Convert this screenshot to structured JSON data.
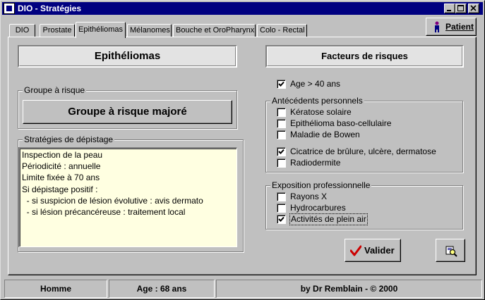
{
  "window": {
    "title": "DIO - Stratégies",
    "controls": [
      "minimize-icon",
      "maximize-icon",
      "close-icon"
    ]
  },
  "tabs": [
    {
      "label": "DIO",
      "active": false
    },
    {
      "label": "Prostate",
      "active": false
    },
    {
      "label": "Epithéliomas",
      "active": true
    },
    {
      "label": "Mélanomes",
      "active": false
    },
    {
      "label": "Bouche et OroPharynx",
      "active": false
    },
    {
      "label": "Colo - Rectal",
      "active": false
    }
  ],
  "patient_button": {
    "label": "Patient",
    "icon": "person-icon"
  },
  "left": {
    "section_title": "Epithéliomas",
    "risk_group": {
      "legend": "Groupe à risque",
      "value": "Groupe à risque majoré"
    },
    "strategies": {
      "legend": "Stratégies de dépistage",
      "lines": [
        "Inspection de la peau",
        "Périodicité : annuelle",
        "Limite fixée à 70 ans",
        "Si dépistage positif :",
        "  - si suspicion de lésion évolutive : avis dermato",
        "  - si lésion précancéreuse : traitement local"
      ]
    }
  },
  "right": {
    "section_title": "Facteurs de risques",
    "age_check": {
      "label": "Age > 40 ans",
      "checked": true
    },
    "antecedents": {
      "legend": "Antécédents personnels",
      "items": [
        {
          "label": "Kératose solaire",
          "checked": false
        },
        {
          "label": "Epithélioma baso-cellulaire",
          "checked": false
        },
        {
          "label": "Maladie de Bowen",
          "checked": false
        },
        {
          "label": "Cicatrice de brûlure, ulcère, dermatose",
          "checked": true
        },
        {
          "label": "Radiodermite",
          "checked": false
        }
      ]
    },
    "exposition": {
      "legend": "Exposition professionnelle",
      "items": [
        {
          "label": "Rayons X",
          "checked": false
        },
        {
          "label": "Hydrocarbures",
          "checked": false
        },
        {
          "label": "Activités de plein air",
          "checked": true
        }
      ]
    }
  },
  "buttons": {
    "validate_label": "Valider",
    "validate_icon": "checkmark-icon",
    "print_icon": "magnifier-print-icon"
  },
  "status": {
    "sex": "Homme",
    "age": "Age : 68 ans",
    "credit": "by Dr Remblain - © 2000"
  },
  "colors": {
    "titlebar": "#000080",
    "face": "#c0c0c0",
    "memo_bg": "#ffffe1",
    "check_red": "#cc0000"
  }
}
